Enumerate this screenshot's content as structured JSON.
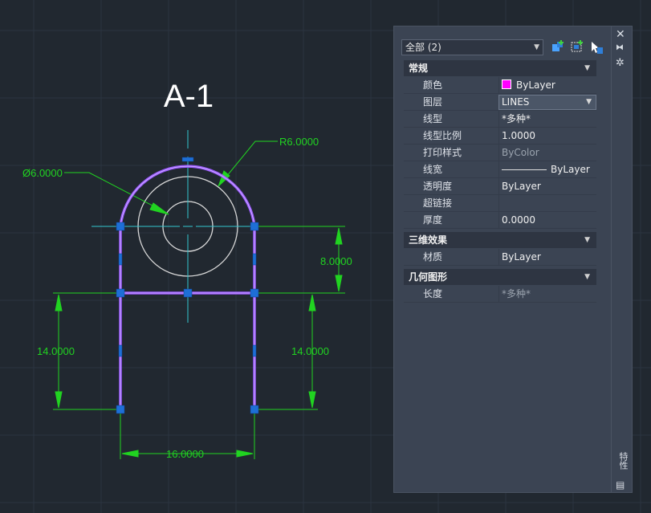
{
  "drawing": {
    "title": "A-1",
    "dimensions": {
      "diameter": "Ø6.0000",
      "radius": "R6.0000",
      "upper_height": "8.0000",
      "left_height": "14.0000",
      "right_height": "14.0000",
      "bottom_width": "16.0000"
    },
    "colors": {
      "background": "#212830",
      "grid": "#2b3440",
      "selected_line": "#9b59ff",
      "dimension": "#21d321",
      "centerline": "#34c7cf",
      "circles": "#d8d8d8",
      "grips": "#1e6fd6"
    }
  },
  "properties": {
    "selection_label": "全部 (2)",
    "toolbar": [
      "select-objects-icon",
      "quick-select-icon",
      "toggle-pickadd-icon"
    ],
    "sections": [
      {
        "title": "常规",
        "rows": [
          {
            "label": "颜色",
            "value": "ByLayer"
          },
          {
            "label": "图层",
            "value": "LINES"
          },
          {
            "label": "线型",
            "value": "*多种*"
          },
          {
            "label": "线型比例",
            "value": "1.0000"
          },
          {
            "label": "打印样式",
            "value": "ByColor"
          },
          {
            "label": "线宽",
            "value": "ByLayer"
          },
          {
            "label": "透明度",
            "value": "ByLayer"
          },
          {
            "label": "超链接",
            "value": ""
          },
          {
            "label": "厚度",
            "value": "0.0000"
          }
        ]
      },
      {
        "title": "三维效果",
        "rows": [
          {
            "label": "材质",
            "value": "ByLayer"
          }
        ]
      },
      {
        "title": "几何图形",
        "rows": [
          {
            "label": "长度",
            "value": "*多种*"
          }
        ]
      }
    ],
    "sidebar_title": "特性",
    "swatch_color": "#ff00ff"
  }
}
